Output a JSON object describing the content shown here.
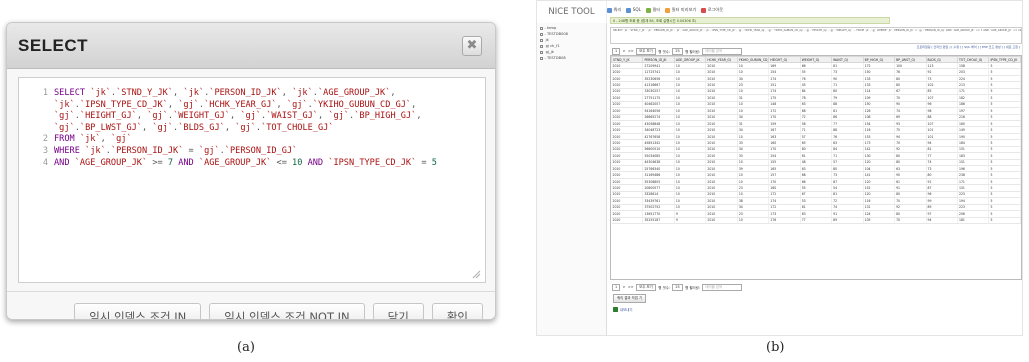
{
  "panel_a": {
    "caption": "(a)",
    "dialog_title": "SELECT",
    "close_glyph": "✖",
    "sql_lines": [
      {
        "num": "1",
        "tokens": [
          {
            "t": "SELECT ",
            "c": "kw"
          },
          {
            "t": "`jk`",
            "c": "str"
          },
          {
            "t": ".",
            "c": "op"
          },
          {
            "t": "`STND_Y_JK`",
            "c": "str"
          },
          {
            "t": ", ",
            "c": "op"
          },
          {
            "t": "`jk`",
            "c": "str"
          },
          {
            "t": ".",
            "c": "op"
          },
          {
            "t": "`PERSON_ID_JK`",
            "c": "str"
          },
          {
            "t": ", ",
            "c": "op"
          },
          {
            "t": "`jk`",
            "c": "str"
          },
          {
            "t": ".",
            "c": "op"
          },
          {
            "t": "`AGE_GROUP_JK`",
            "c": "str"
          },
          {
            "t": ",",
            "c": "op"
          }
        ]
      },
      {
        "num": "",
        "tokens": [
          {
            "t": "`jk`",
            "c": "str"
          },
          {
            "t": ".",
            "c": "op"
          },
          {
            "t": "`IPSN_TYPE_CD_JK`",
            "c": "str"
          },
          {
            "t": ", ",
            "c": "op"
          },
          {
            "t": "`gj`",
            "c": "str"
          },
          {
            "t": ".",
            "c": "op"
          },
          {
            "t": "`HCHK_YEAR_GJ`",
            "c": "str"
          },
          {
            "t": ", ",
            "c": "op"
          },
          {
            "t": "`gj`",
            "c": "str"
          },
          {
            "t": ".",
            "c": "op"
          },
          {
            "t": "`YKIHO_GUBUN_CD_GJ`",
            "c": "str"
          },
          {
            "t": ",",
            "c": "op"
          }
        ]
      },
      {
        "num": "",
        "tokens": [
          {
            "t": "`gj`",
            "c": "str"
          },
          {
            "t": ".",
            "c": "op"
          },
          {
            "t": "`HEIGHT_GJ`",
            "c": "str"
          },
          {
            "t": ", ",
            "c": "op"
          },
          {
            "t": "`gj`",
            "c": "str"
          },
          {
            "t": ".",
            "c": "op"
          },
          {
            "t": "`WEIGHT_GJ`",
            "c": "str"
          },
          {
            "t": ", ",
            "c": "op"
          },
          {
            "t": "`gj`",
            "c": "str"
          },
          {
            "t": ".",
            "c": "op"
          },
          {
            "t": "`WAIST_GJ`",
            "c": "str"
          },
          {
            "t": ", ",
            "c": "op"
          },
          {
            "t": "`gj`",
            "c": "str"
          },
          {
            "t": ".",
            "c": "op"
          },
          {
            "t": "`BP_HIGH_GJ`",
            "c": "str"
          },
          {
            "t": ",",
            "c": "op"
          }
        ]
      },
      {
        "num": "",
        "tokens": [
          {
            "t": "`gj`",
            "c": "str"
          },
          {
            "t": ".",
            "c": "op"
          },
          {
            "t": "`BP_LWST_GJ`",
            "c": "str"
          },
          {
            "t": ", ",
            "c": "op"
          },
          {
            "t": "`gj`",
            "c": "str"
          },
          {
            "t": ".",
            "c": "op"
          },
          {
            "t": "`BLDS_GJ`",
            "c": "str"
          },
          {
            "t": ", ",
            "c": "op"
          },
          {
            "t": "`gj`",
            "c": "str"
          },
          {
            "t": ".",
            "c": "op"
          },
          {
            "t": "`TOT_CHOLE_GJ`",
            "c": "str"
          }
        ]
      },
      {
        "num": "2",
        "tokens": [
          {
            "t": "FROM ",
            "c": "kw"
          },
          {
            "t": "`jk`",
            "c": "str"
          },
          {
            "t": ", ",
            "c": "op"
          },
          {
            "t": "`gj`",
            "c": "str"
          }
        ]
      },
      {
        "num": "3",
        "tokens": [
          {
            "t": "WHERE ",
            "c": "kw"
          },
          {
            "t": "`jk`",
            "c": "str"
          },
          {
            "t": ".",
            "c": "op"
          },
          {
            "t": "`PERSON_ID_JK`",
            "c": "str"
          },
          {
            "t": " = ",
            "c": "op"
          },
          {
            "t": "`gj`",
            "c": "str"
          },
          {
            "t": ".",
            "c": "op"
          },
          {
            "t": "`PERSON_ID_GJ`",
            "c": "str"
          }
        ]
      },
      {
        "num": "4",
        "tokens": [
          {
            "t": "AND ",
            "c": "kw"
          },
          {
            "t": "`AGE_GROUP_JK`",
            "c": "str"
          },
          {
            "t": " >= ",
            "c": "op"
          },
          {
            "t": "7",
            "c": "num"
          },
          {
            "t": " AND ",
            "c": "kw"
          },
          {
            "t": "`AGE_GROUP_JK`",
            "c": "str"
          },
          {
            "t": " <= ",
            "c": "op"
          },
          {
            "t": "10",
            "c": "num"
          },
          {
            "t": " AND ",
            "c": "kw"
          },
          {
            "t": "`IPSN_TYPE_CD_JK`",
            "c": "str"
          },
          {
            "t": " = ",
            "c": "op"
          },
          {
            "t": "5",
            "c": "num"
          }
        ]
      }
    ],
    "buttons": {
      "temp_index_in": "임시 인덱스 조건 IN",
      "temp_index_not_in": "임시 인덱스 조건 NOT IN",
      "close": "닫기",
      "confirm": "확인"
    }
  },
  "panel_b": {
    "caption": "(b)",
    "brand": "NICE TOOL",
    "menu": [
      {
        "label": "쿼리",
        "color": "#5b8fd6"
      },
      {
        "label": "SQL",
        "color": "#5b8fd6"
      },
      {
        "label": "필터",
        "color": "#7cb342"
      },
      {
        "label": "필터 미리보기",
        "color": "#f2a03d"
      },
      {
        "label": "로그아웃",
        "color": "#d84b4b"
      }
    ],
    "tree": [
      "- temp",
      "- TESTDB008",
      "  jk",
      "  gj ch_f1",
      "  gj_jk",
      "- TESTDB08"
    ],
    "message": "0 - 248행 조회 중 (합계 84, 조회 실행시간 0.00306 초)",
    "sql_preview": "SELECT `jk`.`STND_Y_JK`, `jk`.`PERSON_ID_JK`, `jk`.`AGE_GROUP_JK`, `jk`.`IPSN_TYPE_CD_JK`, `gj`.`HCHK_YEAR_GJ`, `gj`.`YKIHO_GUBUN_CD_GJ`, `gj`.`HEIGHT_GJ`, `gj`.`WEIGHT_GJ` ... FROM `jk`, `gj` WHERE `jk`.`PERSON_ID_JK` = `gj`.`PERSON_ID_GJ` AND `AGE_GROUP_JK` >= 7 AND `AGE_GROUP_JK` <= 10 AND `IPSN_TYPE_CD_JK` = 5",
    "links": "프로파일링 [ 인라인 편집 ] [ 수정 ] [ SQL 해석 ] [ PHP 코드 생성 ] [ 새로 고침 ]",
    "pager": {
      "page": "1",
      "next": ">",
      "last": ">>",
      "view_all": "모두 보기",
      "rows_label": "행 갯수:",
      "rows": "25",
      "filter_label": "행 필터링:",
      "filter_placeholder": "테이블 검색"
    },
    "table": {
      "columns": [
        "STND_Y_JK",
        "PERSON_ID_JK",
        "AGE_GROUP_JK",
        "HCHK_YEAR_GJ",
        "YKIHO_GUBUN_CD_GJ",
        "HEIGHT_GJ",
        "WEIGHT_GJ",
        "WAIST_GJ",
        "BP_HIGH_GJ",
        "BP_LWST_GJ",
        "BLDS_GJ",
        "TOT_CHOLE_GJ",
        "IPSN_TYPE_CD_JK"
      ],
      "rows": [
        [
          "2010",
          "27209941",
          "10",
          "2010",
          "10",
          "169",
          "66",
          "81",
          "172",
          "100",
          "113",
          "158",
          "5"
        ],
        [
          "2010",
          "11725741",
          "10",
          "2010",
          "10",
          "154",
          "55",
          "73",
          "150",
          "76",
          "92",
          "203",
          "5"
        ],
        [
          "2010",
          "35230656",
          "10",
          "2010",
          "34",
          "174",
          "76",
          "90",
          "133",
          "80",
          "73",
          "224",
          "5"
        ],
        [
          "2010",
          "41316667",
          "10",
          "2010",
          "23",
          "151",
          "45",
          "71",
          "133",
          "80",
          "102",
          "213",
          "5"
        ],
        [
          "2010",
          "33030257",
          "10",
          "2010",
          "10",
          "174",
          "84",
          "80",
          "114",
          "67",
          "85",
          "171",
          "5"
        ],
        [
          "2010",
          "27751175",
          "10",
          "2010",
          "31",
          "175",
          "78",
          "79",
          "109",
          "70",
          "107",
          "182",
          "5"
        ],
        [
          "2010",
          "40462007",
          "10",
          "2010",
          "10",
          "148",
          "63",
          "88",
          "150",
          "90",
          "96",
          "186",
          "5"
        ],
        [
          "2010",
          "54164056",
          "10",
          "2010",
          "10",
          "172",
          "68",
          "81",
          "126",
          "74",
          "98",
          "197",
          "5"
        ],
        [
          "2010",
          "26665274",
          "10",
          "2010",
          "34",
          "170",
          "72",
          "86",
          "108",
          "69",
          "88",
          "216",
          "5"
        ],
        [
          "2010",
          "43058848",
          "10",
          "2010",
          "31",
          "159",
          "58",
          "77",
          "154",
          "93",
          "107",
          "160",
          "5"
        ],
        [
          "2010",
          "34048723",
          "10",
          "2010",
          "34",
          "167",
          "71",
          "88",
          "116",
          "75",
          "101",
          "149",
          "5"
        ],
        [
          "2010",
          "42767658",
          "10",
          "2010",
          "10",
          "163",
          "57",
          "76",
          "153",
          "94",
          "101",
          "190",
          "5"
        ],
        [
          "2010",
          "45851342",
          "10",
          "2010",
          "33",
          "160",
          "65",
          "83",
          "173",
          "70",
          "94",
          "184",
          "5"
        ],
        [
          "2010",
          "56600510",
          "10",
          "2010",
          "34",
          "170",
          "80",
          "84",
          "142",
          "92",
          "81",
          "151",
          "5"
        ],
        [
          "2010",
          "55034085",
          "10",
          "2010",
          "33",
          "154",
          "61",
          "71",
          "130",
          "80",
          "77",
          "183",
          "5"
        ],
        [
          "2010",
          "44304638",
          "10",
          "2010",
          "10",
          "155",
          "48",
          "57",
          "120",
          "80",
          "74",
          "151",
          "5"
        ],
        [
          "2010",
          "25766340",
          "10",
          "2010",
          "39",
          "165",
          "63",
          "80",
          "104",
          "63",
          "73",
          "196",
          "5"
        ],
        [
          "2010",
          "31169486",
          "10",
          "2010",
          "10",
          "157",
          "68",
          "73",
          "141",
          "90",
          "80",
          "238",
          "5"
        ],
        [
          "2010",
          "55306805",
          "10",
          "2010",
          "10",
          "170",
          "66",
          "87",
          "120",
          "61",
          "91",
          "171",
          "5"
        ],
        [
          "2010",
          "20800577",
          "10",
          "2010",
          "23",
          "160",
          "55",
          "54",
          "152",
          "91",
          "87",
          "151",
          "5"
        ],
        [
          "2010",
          "3328614",
          "10",
          "2010",
          "10",
          "172",
          "67",
          "81",
          "120",
          "80",
          "96",
          "223",
          "5"
        ],
        [
          "2010",
          "33439761",
          "10",
          "2010",
          "38",
          "174",
          "53",
          "72",
          "116",
          "70",
          "99",
          "194",
          "5"
        ],
        [
          "2010",
          "37502752",
          "10",
          "2010",
          "34",
          "172",
          "61",
          "74",
          "131",
          "92",
          "89",
          "223",
          "5"
        ],
        [
          "2010",
          "13651770",
          "9",
          "2010",
          "23",
          "173",
          "63",
          "91",
          "124",
          "80",
          "97",
          "206",
          "5"
        ],
        [
          "2010",
          "35255187",
          "9",
          "2010",
          "10",
          "176",
          "77",
          "89",
          "105",
          "70",
          "94",
          "181",
          "5"
        ]
      ]
    },
    "bottom_button": "쿼리 결과 작업 기",
    "export_link": "내보내기"
  }
}
